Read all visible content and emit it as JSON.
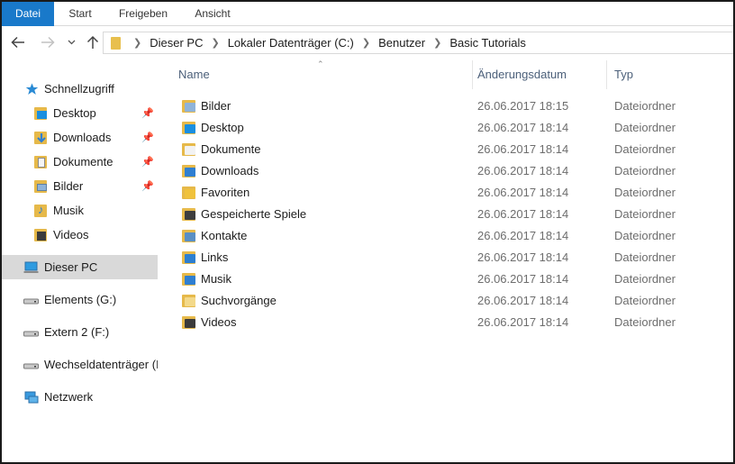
{
  "ribbon": {
    "tabs": [
      {
        "label": "Datei",
        "active": true
      },
      {
        "label": "Start"
      },
      {
        "label": "Freigeben"
      },
      {
        "label": "Ansicht"
      }
    ]
  },
  "nav": {
    "back_icon": "back-arrow-icon",
    "forward_icon": "forward-arrow-icon",
    "recent_icon": "chevron-down-icon",
    "up_icon": "up-arrow-icon"
  },
  "address": {
    "breadcrumbs": [
      "Dieser PC",
      "Lokaler Datenträger (C:)",
      "Benutzer",
      "Basic Tutorials"
    ]
  },
  "sidebar": {
    "quick_access": "Schnellzugriff",
    "quick_items": [
      {
        "label": "Desktop",
        "icon": "desktop-folder-icon",
        "pinned": true
      },
      {
        "label": "Downloads",
        "icon": "downloads-folder-icon",
        "pinned": true
      },
      {
        "label": "Dokumente",
        "icon": "documents-folder-icon",
        "pinned": true
      },
      {
        "label": "Bilder",
        "icon": "pictures-folder-icon",
        "pinned": true
      },
      {
        "label": "Musik",
        "icon": "music-folder-icon",
        "pinned": false
      },
      {
        "label": "Videos",
        "icon": "videos-folder-icon",
        "pinned": false
      }
    ],
    "this_pc": "Dieser PC",
    "drives": [
      {
        "label": "Elements (G:)"
      },
      {
        "label": "Extern 2 (F:)"
      },
      {
        "label": "Wechseldatenträger (I"
      }
    ],
    "network": "Netzwerk"
  },
  "columns": {
    "name": "Name",
    "date": "Änderungsdatum",
    "type": "Typ"
  },
  "files": [
    {
      "name": "Bilder",
      "date": "26.06.2017 18:15",
      "type": "Dateiordner",
      "icon": "pictures-folder-icon",
      "accent": "#8fb3d9"
    },
    {
      "name": "Desktop",
      "date": "26.06.2017 18:14",
      "type": "Dateiordner",
      "icon": "desktop-folder-icon",
      "accent": "#1a8fe0"
    },
    {
      "name": "Dokumente",
      "date": "26.06.2017 18:14",
      "type": "Dateiordner",
      "icon": "documents-folder-icon",
      "accent": "#f2f2f2"
    },
    {
      "name": "Downloads",
      "date": "26.06.2017 18:14",
      "type": "Dateiordner",
      "icon": "downloads-folder-icon",
      "accent": "#2f7fd1"
    },
    {
      "name": "Favoriten",
      "date": "26.06.2017 18:14",
      "type": "Dateiordner",
      "icon": "favorites-folder-icon",
      "accent": "#f0c23c"
    },
    {
      "name": "Gespeicherte Spiele",
      "date": "26.06.2017 18:14",
      "type": "Dateiordner",
      "icon": "saved-games-folder-icon",
      "accent": "#3d3d3d"
    },
    {
      "name": "Kontakte",
      "date": "26.06.2017 18:14",
      "type": "Dateiordner",
      "icon": "contacts-folder-icon",
      "accent": "#5a8fc4"
    },
    {
      "name": "Links",
      "date": "26.06.2017 18:14",
      "type": "Dateiordner",
      "icon": "links-folder-icon",
      "accent": "#2d7fd0"
    },
    {
      "name": "Musik",
      "date": "26.06.2017 18:14",
      "type": "Dateiordner",
      "icon": "music-folder-icon",
      "accent": "#2f7fd1"
    },
    {
      "name": "Suchvorgänge",
      "date": "26.06.2017 18:14",
      "type": "Dateiordner",
      "icon": "searches-folder-icon",
      "accent": "#f3d98a"
    },
    {
      "name": "Videos",
      "date": "26.06.2017 18:14",
      "type": "Dateiordner",
      "icon": "videos-folder-icon",
      "accent": "#3b3b3b"
    }
  ],
  "colors": {
    "accent": "#1979ca",
    "folder": "#e6b94a",
    "header_text": "#4c607a",
    "selected_bg": "#d9d9d9"
  }
}
